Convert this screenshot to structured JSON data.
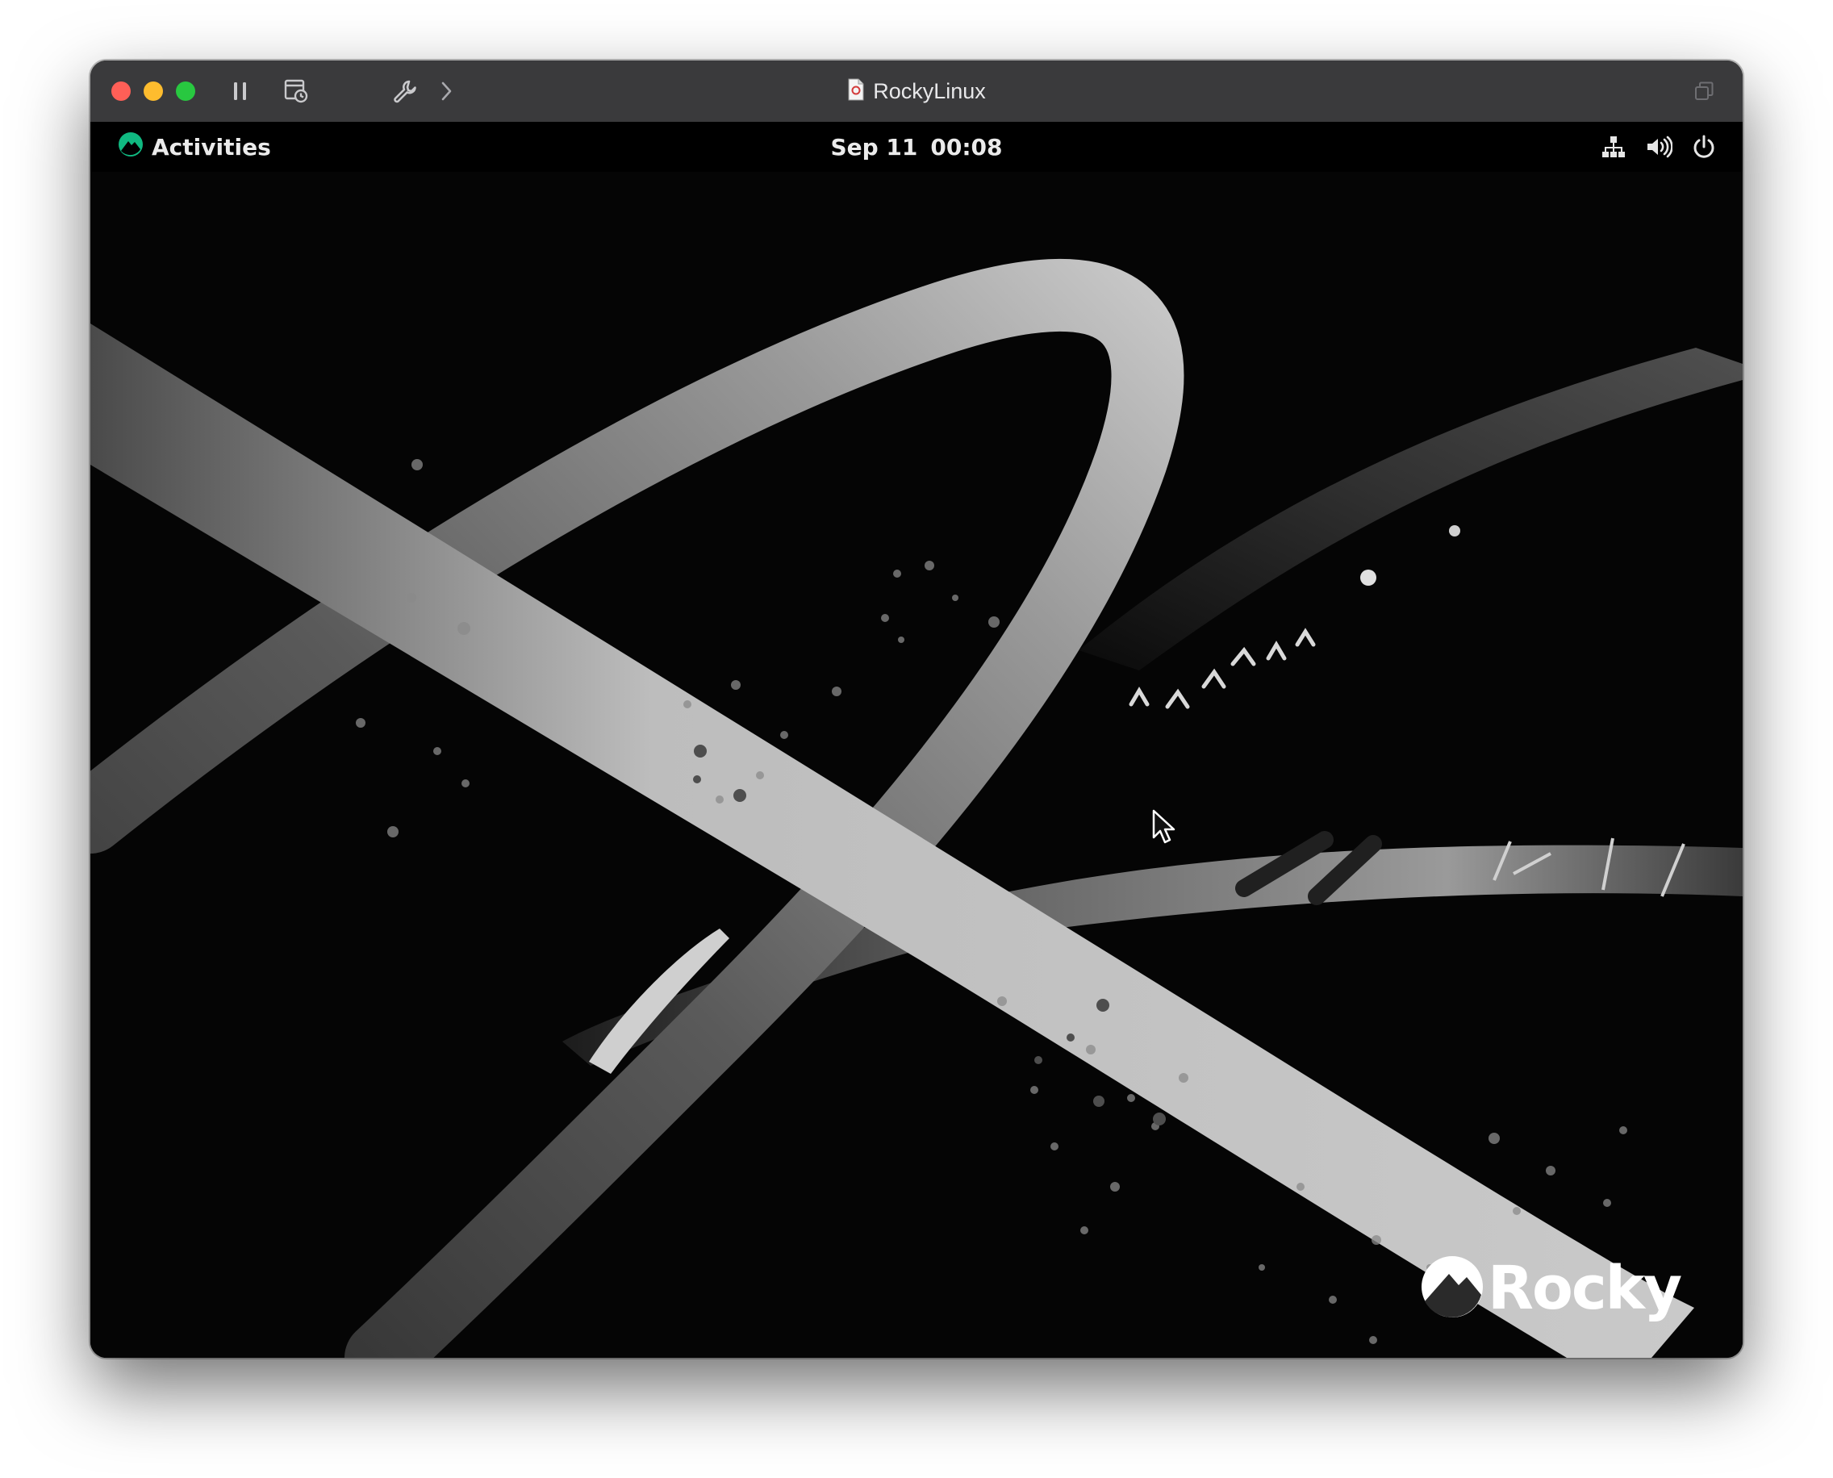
{
  "window": {
    "title": "RockyLinux",
    "title_icon": "document-icon",
    "traffic_lights": {
      "close": "#ff5f57",
      "minimize": "#febc2e",
      "maximize": "#28c840"
    },
    "toolbar_icons": [
      "pause-icon",
      "snapshot-icon",
      "wrench-icon",
      "chevron-right-icon"
    ],
    "right_icon": "restore-window-icon"
  },
  "gnome_topbar": {
    "activities_label": "Activities",
    "activities_icon": "rocky-linux-icon",
    "accent_color": "#10b981",
    "clock_date": "Sep 11",
    "clock_time": "00:08",
    "status_icons": [
      "network-wired-icon",
      "volume-icon",
      "power-icon"
    ]
  },
  "desktop": {
    "wallpaper_logo_text": "Rocky",
    "cursor_icon": "mouse-pointer-icon"
  }
}
